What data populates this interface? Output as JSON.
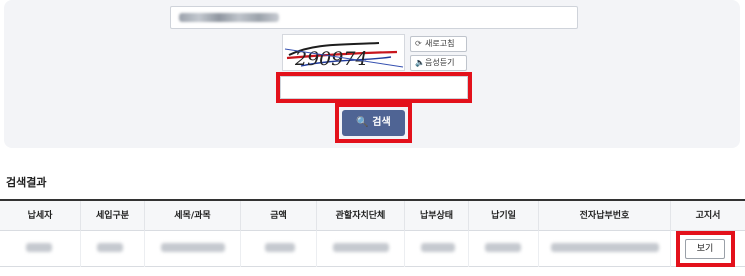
{
  "captcha": {
    "text": "290974",
    "refresh_label": "새로고침",
    "audio_label": "음성듣기"
  },
  "search": {
    "button_label": "검색"
  },
  "results": {
    "title": "검색결과",
    "columns": [
      "납세자",
      "세입구분",
      "세목/과목",
      "금액",
      "관할자치단체",
      "납부상태",
      "납기일",
      "전자납부번호",
      "고지서"
    ],
    "view_label": "보기"
  },
  "colors": {
    "highlight": "#e3111b",
    "search_button": "#4f6494",
    "panel_bg": "#f3f4f7"
  }
}
